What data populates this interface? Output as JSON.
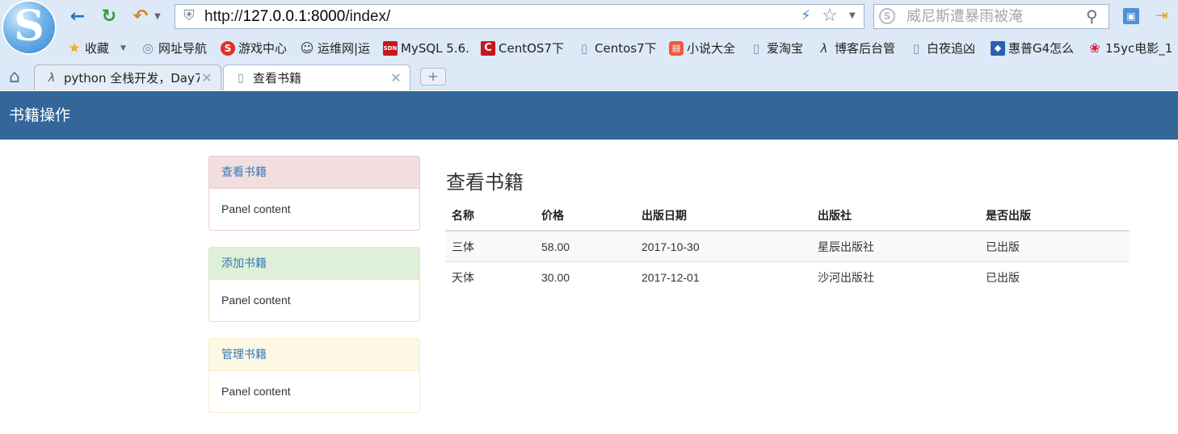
{
  "browser": {
    "url_prefix": "http://",
    "url_host": "127.0.0.1:8000",
    "url_path": "/index/",
    "search_placeholder": "威尼斯遭暴雨被淹",
    "bookmarks": [
      {
        "label": "收藏",
        "icon": "star-icon",
        "color": "#e8b51a"
      },
      {
        "label": "网址导航",
        "icon": "globe-icon",
        "color": "#7a8fa6"
      },
      {
        "label": "游戏中心",
        "icon": "game-icon",
        "color": "#e0302a"
      },
      {
        "label": "运维网|运",
        "icon": "penguin-icon",
        "color": "#333333"
      },
      {
        "label": "MySQL 5.6.",
        "icon": "csdn-icon",
        "color": "#c8161d"
      },
      {
        "label": "CentOS7下",
        "icon": "c-logo-icon",
        "color": "#c8161d"
      },
      {
        "label": "Centos7下",
        "icon": "page-icon",
        "color": "#7a8fa6"
      },
      {
        "label": "小说大全",
        "icon": "book-icon",
        "color": "#f05a3a"
      },
      {
        "label": "爱淘宝",
        "icon": "page-icon",
        "color": "#7a8fa6"
      },
      {
        "label": "博客后台管",
        "icon": "blog-icon",
        "color": "#333333"
      },
      {
        "label": "白夜追凶",
        "icon": "page-icon",
        "color": "#7a8fa6"
      },
      {
        "label": "惠普G4怎么",
        "icon": "paw-icon",
        "color": "#2b5fb3"
      },
      {
        "label": "15yc电影_1",
        "icon": "flower-icon",
        "color": "#d61f3c"
      }
    ],
    "tabs": [
      {
        "label": "python 全栈开发，Day7",
        "icon": "blog-icon",
        "active": false
      },
      {
        "label": "查看书籍",
        "icon": "page-icon",
        "active": true
      }
    ],
    "new_tab_label": "+"
  },
  "page": {
    "brand": "书籍操作",
    "panels": [
      {
        "heading": "查看书籍",
        "body": "Panel content"
      },
      {
        "heading": "添加书籍",
        "body": "Panel content"
      },
      {
        "heading": "管理书籍",
        "body": "Panel content"
      }
    ],
    "content_title": "查看书籍",
    "table": {
      "headers": [
        "名称",
        "价格",
        "出版日期",
        "出版社",
        "是否出版"
      ],
      "rows": [
        [
          "三体",
          "58.00",
          "2017-10-30",
          "星辰出版社",
          "已出版"
        ],
        [
          "天体",
          "30.00",
          "2017-12-01",
          "沙河出版社",
          "已出版"
        ]
      ]
    }
  },
  "colors": {
    "navbar": "#336699",
    "panel_danger_heading": "#f2dede",
    "panel_success_heading": "#dff0d8",
    "panel_warning_heading": "#fcf8e3",
    "link": "#337ab7"
  }
}
